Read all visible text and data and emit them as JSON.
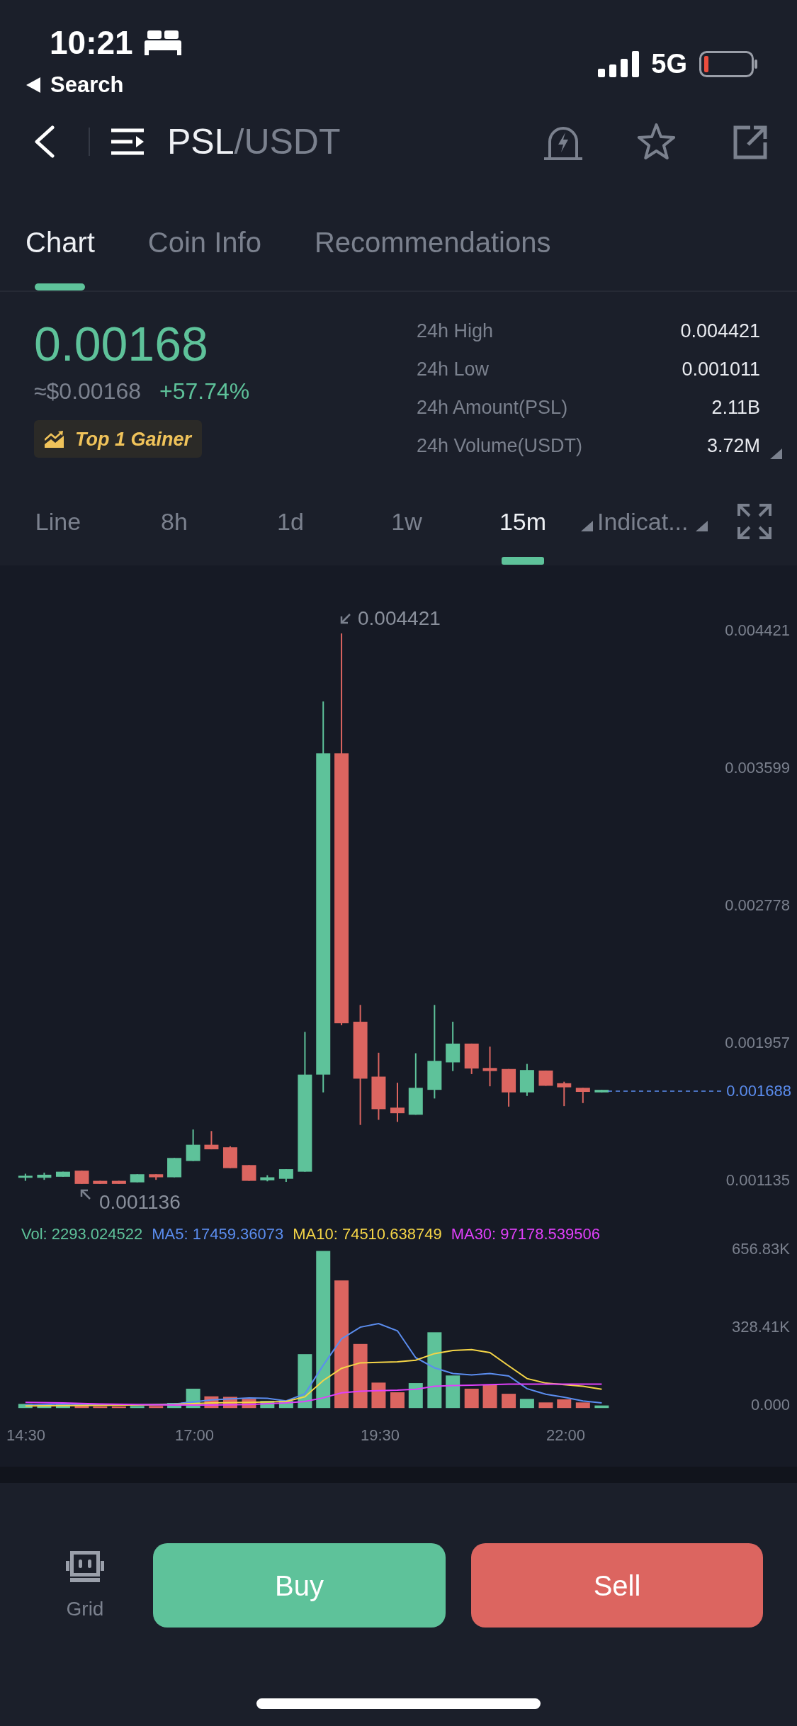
{
  "status_bar": {
    "time": "10:21",
    "back_label": "Search",
    "network": "5G"
  },
  "header": {
    "base_symbol": "PSL",
    "quote_symbol": "/USDT"
  },
  "tabs": [
    {
      "label": "Chart",
      "selected": true
    },
    {
      "label": "Coin Info",
      "selected": false
    },
    {
      "label": "Recommendations",
      "selected": false
    }
  ],
  "ticker": {
    "price": "0.00168",
    "fiat_price": "≈$0.00168",
    "change": "+57.74%",
    "badge": "Top 1 Gainer"
  },
  "stats": [
    {
      "label": "24h High",
      "value": "0.004421"
    },
    {
      "label": "24h Low",
      "value": "0.001011"
    },
    {
      "label": "24h Amount(PSL)",
      "value": "2.11B"
    },
    {
      "label": "24h Volume(USDT)",
      "value": "3.72M"
    }
  ],
  "periods": [
    {
      "label": "Line",
      "selected": false
    },
    {
      "label": "8h",
      "selected": false
    },
    {
      "label": "1d",
      "selected": false
    },
    {
      "label": "1w",
      "selected": false
    },
    {
      "label": "15m",
      "selected": true
    }
  ],
  "indicators": {
    "label": "Indicat..."
  },
  "chart": {
    "high_marker": "0.004421",
    "low_marker": "0.001136",
    "price_ticks": [
      "0.004421",
      "0.003599",
      "0.002778",
      "0.001957",
      "0.001135"
    ],
    "last_price": "0.001688",
    "legend": [
      {
        "label": "Vol: 2293.024522",
        "color": "#5ec29a"
      },
      {
        "label": "MA5: 17459.36073",
        "color": "#5b8def"
      },
      {
        "label": "MA10: 74510.638749",
        "color": "#f5d547"
      },
      {
        "label": "MA30: 97178.539506",
        "color": "#e040fb"
      }
    ],
    "volume_ticks": [
      "656.83K",
      "328.41K",
      "0.000"
    ],
    "time_ticks": [
      "14:30",
      "17:00",
      "19:30",
      "22:00"
    ]
  },
  "trade_bar": {
    "grid_label": "Grid",
    "buttons": [
      {
        "label": "Buy",
        "kind": "buy"
      },
      {
        "label": "Sell",
        "kind": "sell"
      }
    ]
  }
}
